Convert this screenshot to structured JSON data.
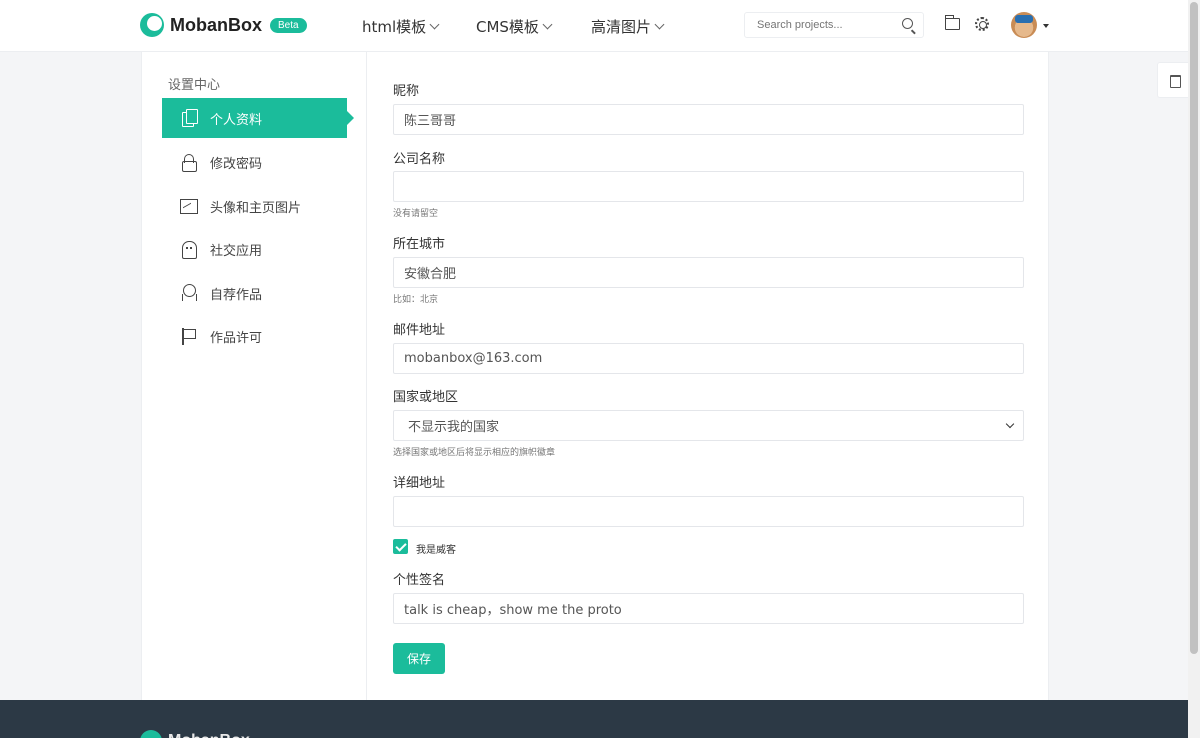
{
  "brand": {
    "name": "MobanBox",
    "badge": "Beta",
    "accent": "#1bbc9b"
  },
  "nav": {
    "items": [
      {
        "label": "html模板"
      },
      {
        "label": "CMS模板"
      },
      {
        "label": "高清图片"
      }
    ],
    "search_placeholder": "Search projects..."
  },
  "sidebar": {
    "title": "设置中心",
    "items": [
      {
        "label": "个人资料",
        "icon": "documents-icon",
        "active": true
      },
      {
        "label": "修改密码",
        "icon": "lock-icon"
      },
      {
        "label": "头像和主页图片",
        "icon": "image-icon"
      },
      {
        "label": "社交应用",
        "icon": "ghost-icon"
      },
      {
        "label": "自荐作品",
        "icon": "award-icon"
      },
      {
        "label": "作品许可",
        "icon": "flag-icon"
      }
    ]
  },
  "form": {
    "nickname": {
      "label": "昵称",
      "value": "陈三哥哥"
    },
    "company": {
      "label": "公司名称",
      "value": "",
      "hint": "没有请留空"
    },
    "city": {
      "label": "所在城市",
      "value": "安徽合肥",
      "hint": "比如：北京"
    },
    "email": {
      "label": "邮件地址",
      "value": "mobanbox@163.com"
    },
    "country": {
      "label": "国家或地区",
      "selected": "不显示我的国家",
      "hint": "选择国家或地区后将显示相应的旗帜徽章"
    },
    "address": {
      "label": "详细地址",
      "value": ""
    },
    "hire": {
      "label": "我是威客",
      "checked": true
    },
    "signature": {
      "label": "个性签名",
      "value": "talk is cheap，show me the proto"
    },
    "save_label": "保存"
  }
}
